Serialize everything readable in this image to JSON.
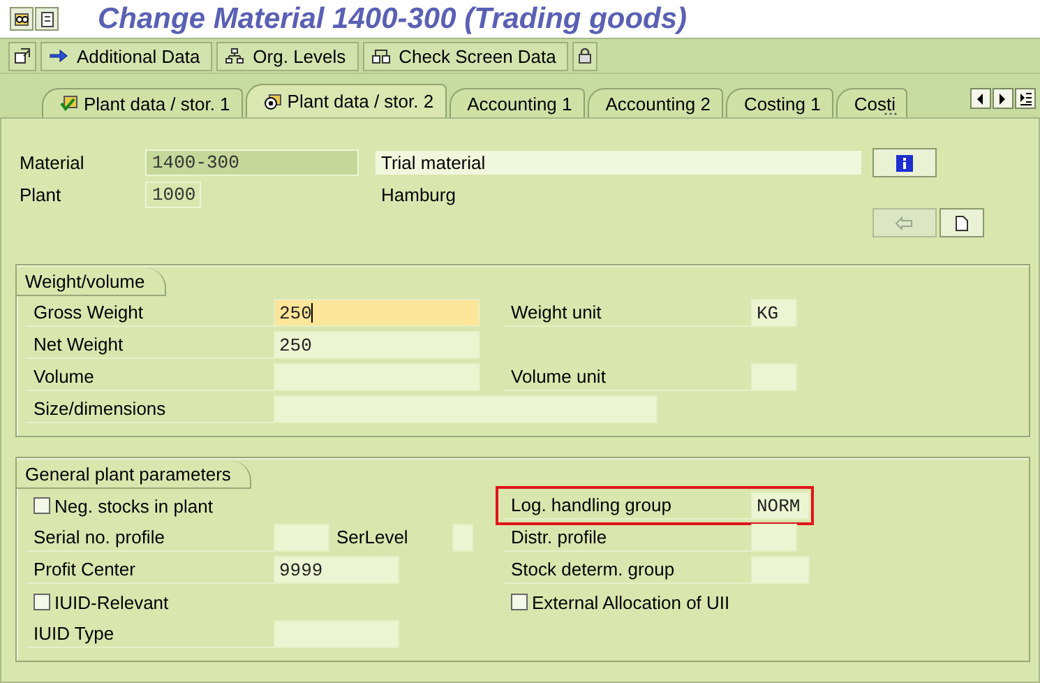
{
  "window": {
    "title": "Change Material 1400-300 (Trading goods)"
  },
  "toolbar": [
    {
      "kind": "arrow",
      "label": "Additional Data"
    },
    {
      "kind": "hierarchy",
      "label": "Org. Levels"
    },
    {
      "kind": "check",
      "label": "Check Screen Data"
    }
  ],
  "tabs": [
    {
      "label": "Plant data / stor. 1",
      "selected": false,
      "cut": false
    },
    {
      "label": "Plant data / stor. 2",
      "selected": true,
      "cut": false
    },
    {
      "label": "Accounting 1",
      "selected": false,
      "cut": false
    },
    {
      "label": "Accounting 2",
      "selected": false,
      "cut": false
    },
    {
      "label": "Costing 1",
      "selected": false,
      "cut": false
    },
    {
      "label": "Costi",
      "selected": false,
      "cut": true
    }
  ],
  "header": [
    {
      "label": "Material",
      "value": "1400-300",
      "description": "Trial material"
    },
    {
      "label": "Plant",
      "value": "1000",
      "description": "Hamburg"
    }
  ],
  "sections": [
    {
      "title": "Weight/volume",
      "rows": [
        {
          "highlighted": false,
          "left": [
            {
              "kind": "label",
              "text": "Gross Weight"
            },
            {
              "kind": "field",
              "value": "250",
              "focused": true
            }
          ],
          "right": [
            {
              "kind": "label",
              "text": "Weight unit"
            },
            {
              "kind": "field",
              "value": "KG",
              "focused": false
            }
          ]
        },
        {
          "highlighted": false,
          "left": [
            {
              "kind": "label",
              "text": "Net Weight"
            },
            {
              "kind": "field",
              "value": "250",
              "focused": false
            }
          ],
          "right": []
        },
        {
          "highlighted": false,
          "left": [
            {
              "kind": "label",
              "text": "Volume"
            },
            {
              "kind": "field",
              "focused": false
            }
          ],
          "right": [
            {
              "kind": "label",
              "text": "Volume unit"
            },
            {
              "kind": "field",
              "focused": false
            }
          ]
        },
        {
          "highlighted": false,
          "left": [
            {
              "kind": "label",
              "text": "Size/dimensions"
            },
            {
              "kind": "field",
              "focused": false
            }
          ],
          "right": []
        }
      ]
    },
    {
      "title": "General plant parameters",
      "rows": [
        {
          "highlighted": true,
          "left": [
            {
              "kind": "checkbox",
              "text": "Neg. stocks in plant",
              "checked": false
            }
          ],
          "right": [
            {
              "kind": "label",
              "text": "Log. handling group"
            },
            {
              "kind": "field",
              "value": "NORM",
              "focused": false
            }
          ]
        },
        {
          "highlighted": false,
          "left": [
            {
              "kind": "label",
              "text": "Serial no. profile"
            },
            {
              "kind": "field",
              "focused": false
            },
            {
              "kind": "label",
              "text": "SerLevel"
            },
            {
              "kind": "field",
              "focused": false
            }
          ],
          "right": [
            {
              "kind": "label",
              "text": "Distr. profile"
            },
            {
              "kind": "field",
              "focused": false
            }
          ]
        },
        {
          "highlighted": false,
          "left": [
            {
              "kind": "label",
              "text": "Profit Center"
            },
            {
              "kind": "field",
              "value": "9999",
              "focused": false
            }
          ],
          "right": [
            {
              "kind": "label",
              "text": "Stock determ. group"
            },
            {
              "kind": "field",
              "focused": false
            }
          ]
        },
        {
          "highlighted": false,
          "left": [
            {
              "kind": "checkbox",
              "text": "IUID-Relevant",
              "checked": false
            }
          ],
          "right": [
            {
              "kind": "checkbox",
              "text": "External Allocation of UII",
              "checked": false
            }
          ]
        },
        {
          "highlighted": false,
          "left": [
            {
              "kind": "label",
              "text": "IUID Type"
            },
            {
              "kind": "field",
              "focused": false
            }
          ],
          "right": []
        }
      ]
    }
  ]
}
